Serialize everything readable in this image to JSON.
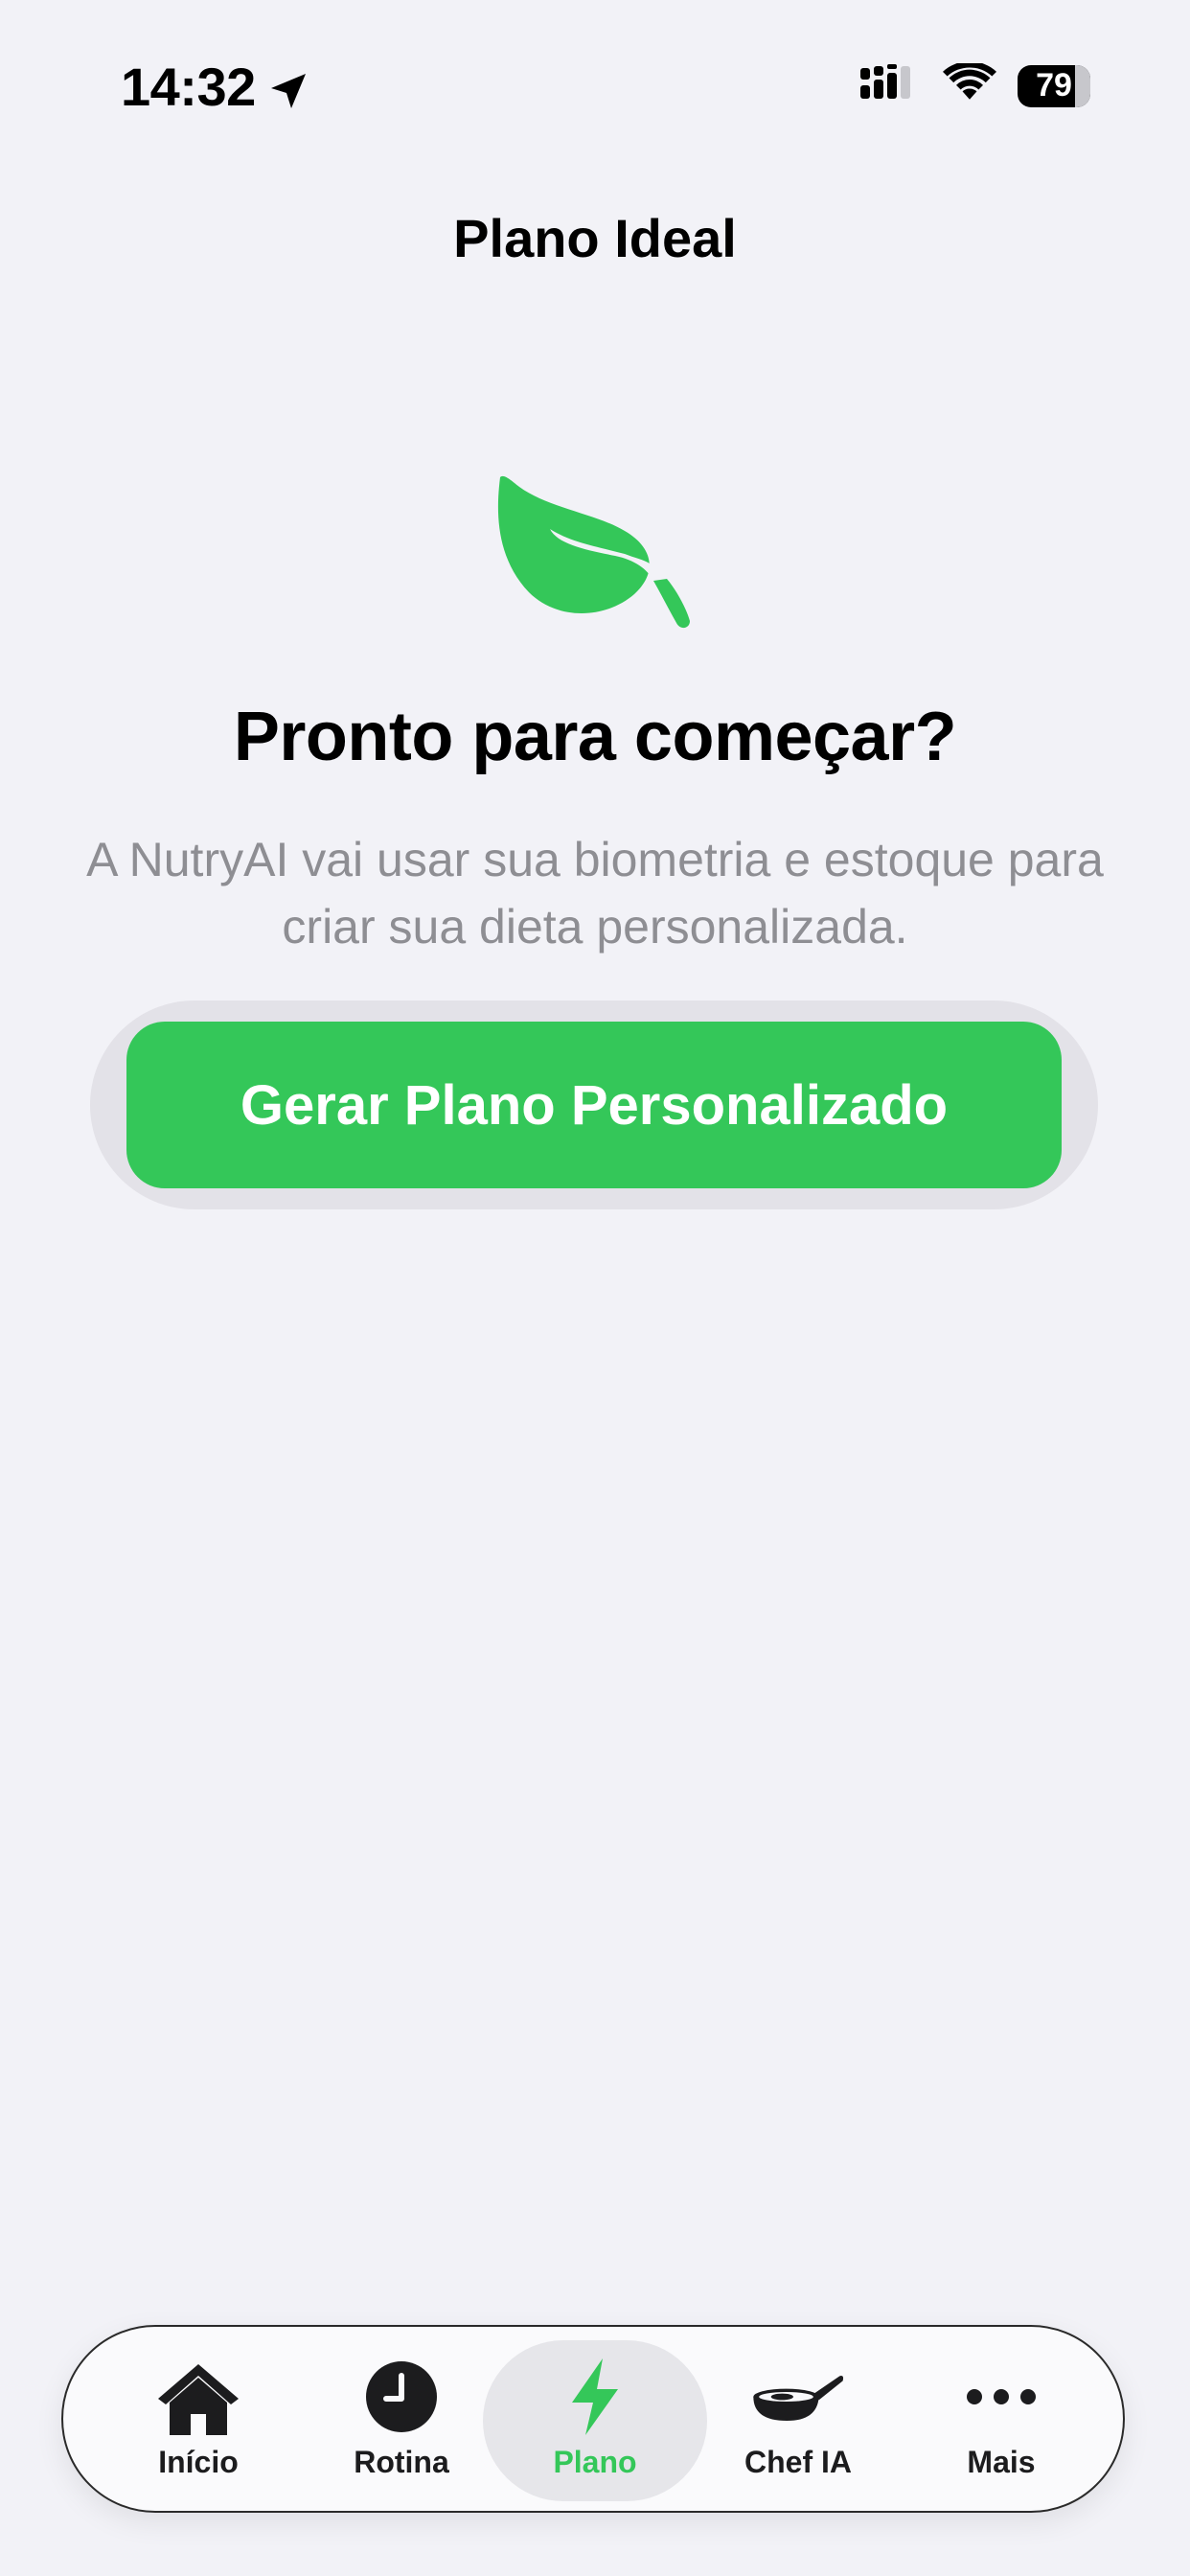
{
  "status_bar": {
    "time": "14:32",
    "battery": "79",
    "icons": [
      "location-arrow-icon",
      "cellular-signal-icon",
      "wifi-icon",
      "battery-icon"
    ]
  },
  "nav": {
    "title": "Plano Ideal"
  },
  "hero": {
    "icon": "leaf-icon",
    "title": "Pronto para começar?",
    "subtitle": "A NutryAI vai usar sua biometria e estoque para criar sua dieta personalizada."
  },
  "cta": {
    "label": "Gerar Plano Personalizado"
  },
  "tab_bar": {
    "active_index": 2,
    "items": [
      {
        "label": "Início",
        "icon": "house-icon"
      },
      {
        "label": "Rotina",
        "icon": "clock-icon"
      },
      {
        "label": "Plano",
        "icon": "bolt-icon"
      },
      {
        "label": "Chef IA",
        "icon": "frying-pan-icon"
      },
      {
        "label": "Mais",
        "icon": "ellipsis-icon"
      }
    ]
  },
  "colors": {
    "accent": "#34c759",
    "background": "#f2f2f7",
    "secondary_text": "#8e8e93"
  }
}
